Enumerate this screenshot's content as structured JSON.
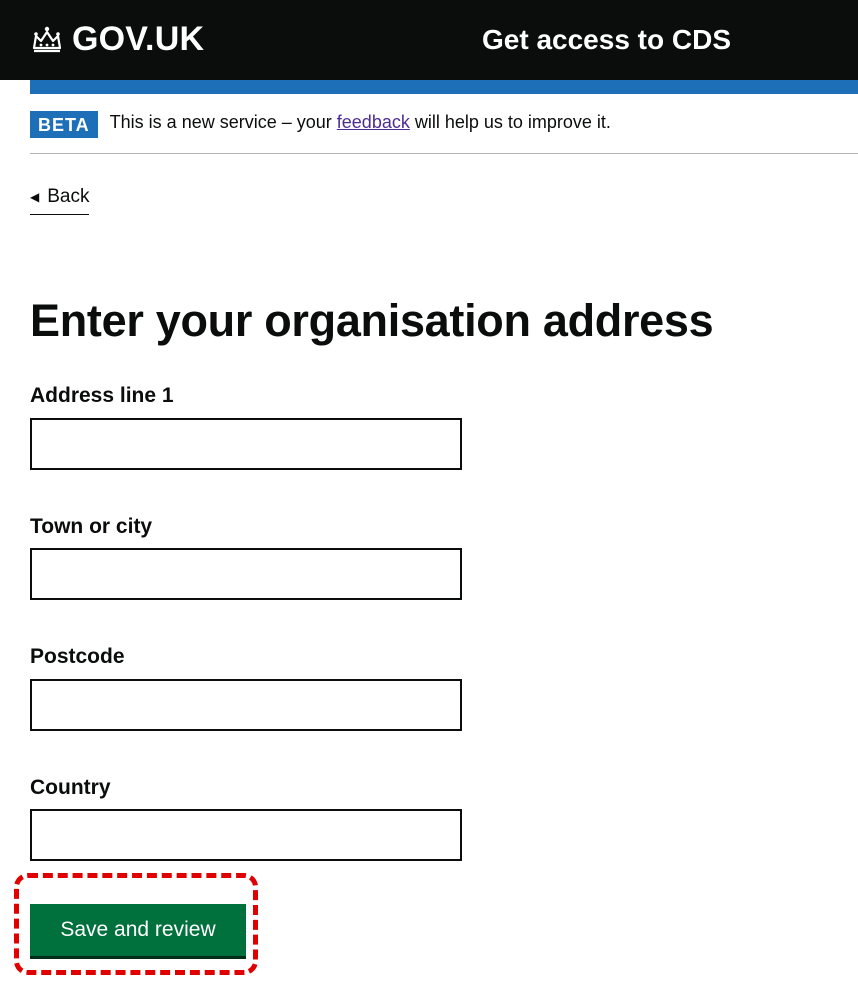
{
  "header": {
    "logo_text": "GOV.UK",
    "logo_icon": "crown-icon",
    "service_name": "Get access to CDS"
  },
  "phase_banner": {
    "tag": "BETA",
    "text_before": "This is a new service – your",
    "link_text": "feedback",
    "text_after": "will help us to improve it."
  },
  "back_link": {
    "label": "Back",
    "icon": "back-arrow-icon"
  },
  "main": {
    "title": "Enter your organisation address",
    "fields": [
      {
        "label": "Address line 1",
        "value": "",
        "placeholder": ""
      },
      {
        "label": "Town or city",
        "value": "",
        "placeholder": ""
      },
      {
        "label": "Postcode",
        "value": "",
        "placeholder": ""
      },
      {
        "label": "Country",
        "value": "",
        "placeholder": ""
      }
    ],
    "submit_label": "Save and review"
  },
  "colors": {
    "header_bg": "#0b0c0c",
    "accent_blue": "#1d70b8",
    "button_green": "#00703c",
    "link_purple": "#4c2c92",
    "highlight_red": "#e00000"
  }
}
